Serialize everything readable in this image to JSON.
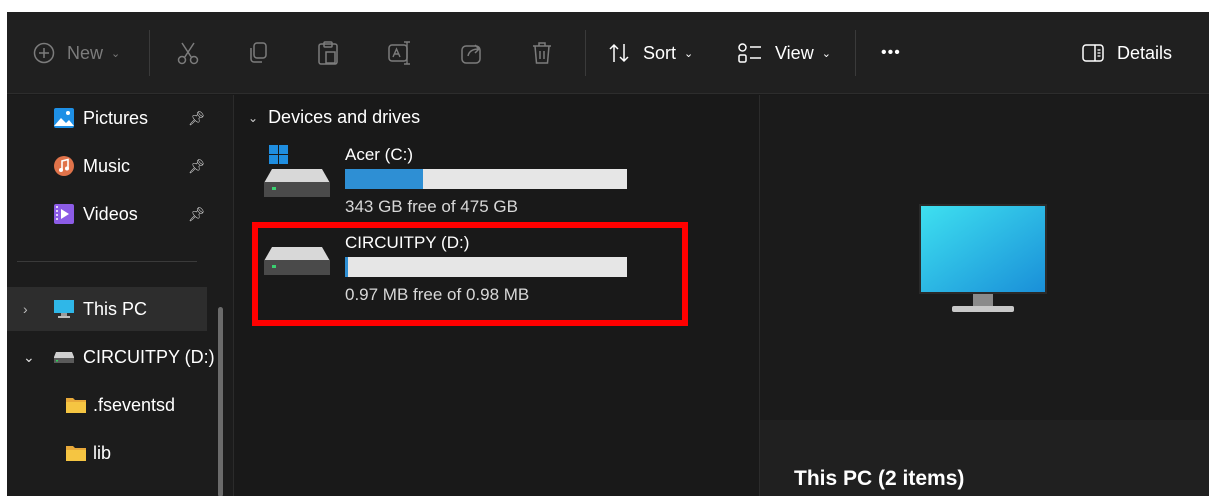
{
  "toolbar": {
    "new_label": "New",
    "sort_label": "Sort",
    "view_label": "View",
    "more_label": "•••",
    "details_label": "Details"
  },
  "sidebar": {
    "quick_access": [
      {
        "label": "Pictures",
        "icon": "pictures-icon",
        "pinned": true
      },
      {
        "label": "Music",
        "icon": "music-icon",
        "pinned": true
      },
      {
        "label": "Videos",
        "icon": "videos-icon",
        "pinned": true
      }
    ],
    "tree": [
      {
        "label": "This PC",
        "icon": "monitor-icon",
        "expanded": false,
        "selected": true
      },
      {
        "label": "CIRCUITPY (D:)",
        "icon": "drive-icon",
        "expanded": true,
        "selected": false
      },
      {
        "label": ".fseventsd",
        "icon": "folder-icon"
      },
      {
        "label": "lib",
        "icon": "folder-icon"
      }
    ]
  },
  "content": {
    "group_header": "Devices and drives",
    "drives": [
      {
        "name": "Acer (C:)",
        "free_text": "343 GB free of 475 GB",
        "used_fraction": 0.278
      },
      {
        "name": "CIRCUITPY (D:)",
        "free_text": "0.97 MB free of 0.98 MB",
        "used_fraction": 0.01
      }
    ]
  },
  "details_pane": {
    "title": "This PC (2 items)"
  },
  "colors": {
    "highlight": "#ff0000",
    "bar_fill": "#2e8fd4",
    "bar_track": "#e6e6e6",
    "window_bg": "#191919"
  }
}
